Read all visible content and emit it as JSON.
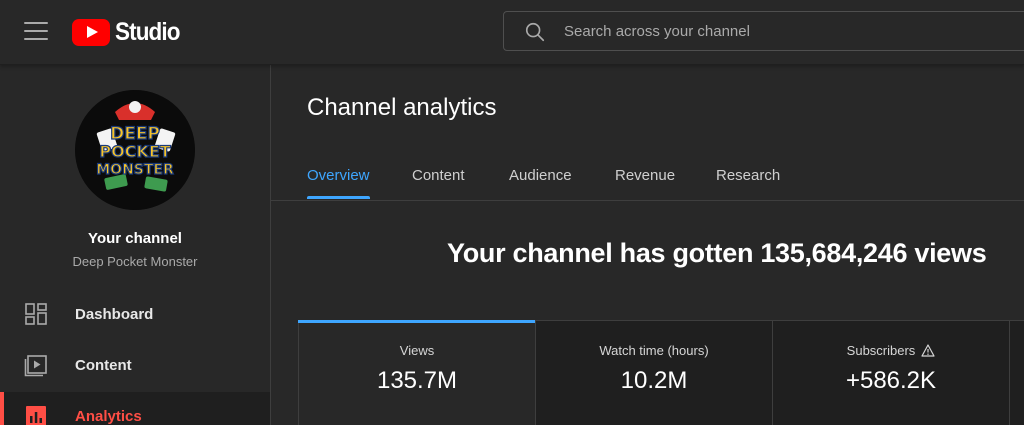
{
  "header": {
    "logo_text": "Studio",
    "search": {
      "placeholder": "Search across your channel"
    }
  },
  "sidebar": {
    "channel_title": "Your channel",
    "channel_name": "Deep Pocket Monster",
    "avatar_text": [
      "DEEP",
      "POCKET",
      "MONSTER"
    ],
    "items": [
      {
        "label": "Dashboard",
        "icon": "dashboard-icon",
        "active": false
      },
      {
        "label": "Content",
        "icon": "content-icon",
        "active": false
      },
      {
        "label": "Analytics",
        "icon": "analytics-icon",
        "active": true
      }
    ]
  },
  "main": {
    "title": "Channel analytics",
    "tabs": [
      {
        "label": "Overview",
        "active": true
      },
      {
        "label": "Content",
        "active": false
      },
      {
        "label": "Audience",
        "active": false
      },
      {
        "label": "Revenue",
        "active": false
      },
      {
        "label": "Research",
        "active": false
      }
    ],
    "headline": "Your channel has gotten 135,684,246 views",
    "cards": [
      {
        "label": "Views",
        "value": "135.7M",
        "active": true
      },
      {
        "label": "Watch time (hours)",
        "value": "10.2M",
        "active": false
      },
      {
        "label": "Subscribers",
        "value": "+586.2K",
        "active": false,
        "icon": "warning-icon"
      }
    ]
  },
  "colors": {
    "background": "#282828",
    "accent_blue": "#3ea6ff",
    "accent_red": "#ff4e45",
    "brand_red": "#ff0000"
  }
}
